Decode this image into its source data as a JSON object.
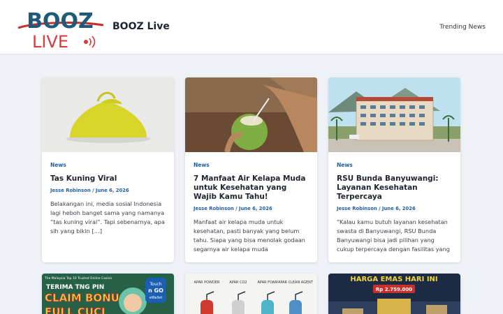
{
  "header": {
    "logo_top": "BOOZ",
    "logo_bottom": "LIVE",
    "site_name": "BOOZ Live",
    "nav": [
      "Trending News"
    ]
  },
  "posts": [
    {
      "category": "News",
      "title": "Tas Kuning Viral",
      "author": "Jesse Robinson",
      "date": "June 6, 2026",
      "excerpt": "Belakangan ini, media sosial Indonesia lagi heboh banget sama yang namanya “tas kuning viral”. Tapi sebenarnya, apa sih yang bikin […]"
    },
    {
      "category": "News",
      "title": "7 Manfaat Air Kelapa Muda untuk Kesehatan yang Wajib Kamu Tahu!",
      "author": "Jesse Robinson",
      "date": "June 6, 2026",
      "excerpt": "Manfaat air kelapa muda untuk kesehatan, pasti banyak yang belum tahu. Siapa yang bisa menolak godaan segarnya air kelapa muda"
    },
    {
      "category": "News",
      "title": "RSU Bunda Banyuwangi: Layanan Kesehatan Terpercaya",
      "author": "Jesse Robinson",
      "date": "June 6, 2026",
      "excerpt": "“Kalau kamu butuh layanan kesehatan swasta di Banyuwangi, RSU Bunda Banyuwangi bisa jadi pilihan yang cukup terpercaya dengan fasilitas yang"
    }
  ],
  "row2": [
    {
      "thumb_small": "The Malaysia Top 10 Trusted Online Casino",
      "thumb_line1": "TERIMA TNG PIN",
      "thumb_line2": "CLAIM BONUS",
      "thumb_line3": "FULL CUCI",
      "thumb_badge_1": "Touch",
      "thumb_badge_2": "n GO",
      "thumb_badge_3": "eWallet"
    },
    {
      "labels": [
        "APAR POWDER",
        "APAR CO2",
        "APAR FOAM",
        "APAR CLEAN AGENT"
      ]
    },
    {
      "heading": "HARGA EMAS HARI INI",
      "price": "Rp 2.759.000"
    }
  ]
}
